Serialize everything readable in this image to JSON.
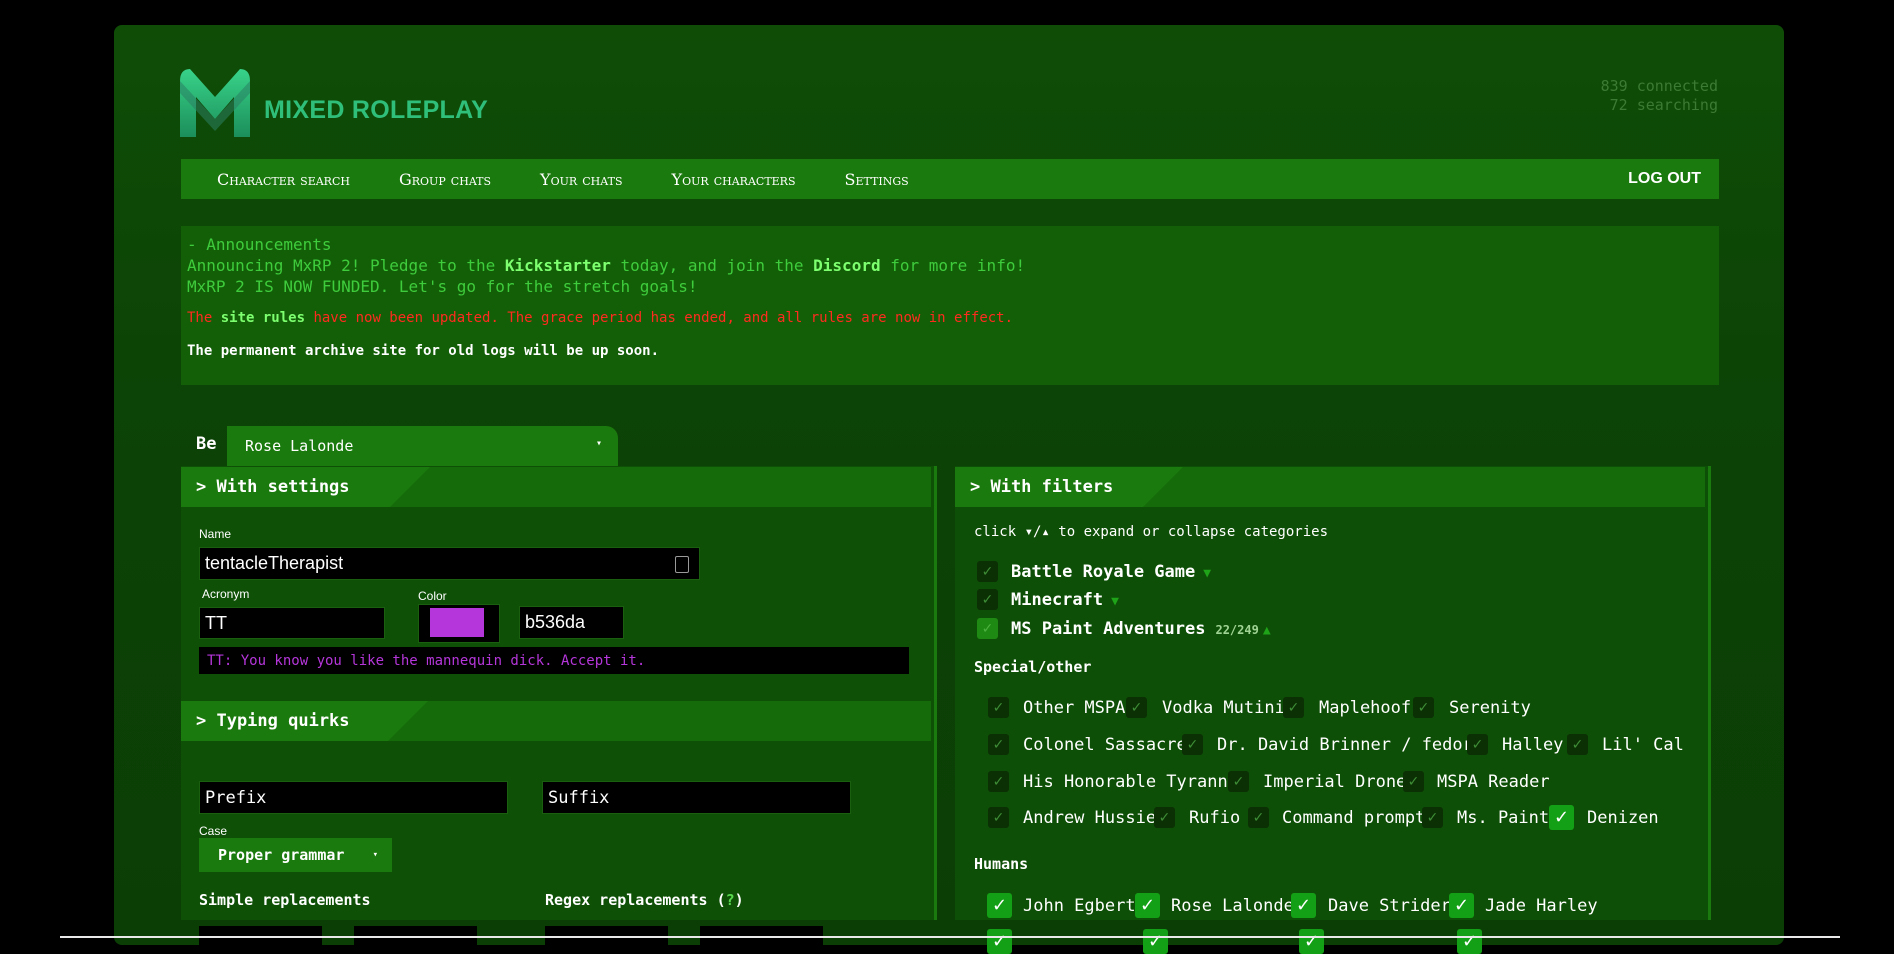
{
  "brand": {
    "name": "MIXED ROLEPLAY"
  },
  "stats": {
    "connected": "839 connected",
    "searching": "72 searching"
  },
  "nav": {
    "items": [
      "Character search",
      "Group chats",
      "Your chats",
      "Your characters",
      "Settings"
    ],
    "logout": "LOG OUT"
  },
  "announcements": {
    "title": "- Announcements",
    "line1_pre": "Announcing MxRP 2! Pledge to the ",
    "line1_link1": "Kickstarter",
    "line1_mid": " today, and join the ",
    "line1_link2": "Discord",
    "line1_post": " for more info!",
    "line2": "MxRP 2 IS NOW FUNDED. Let's go for the stretch goals!",
    "rules_pre": "The ",
    "rules_link": "site rules",
    "rules_post": " have now been updated. The grace period has ended, and all rules are now in effect.",
    "archive": "The permanent archive site for old logs will be up soon."
  },
  "be": {
    "label": "Be",
    "character": "Rose Lalonde",
    "caret": "▾"
  },
  "settings": {
    "heading": "> With settings",
    "name_label": "Name",
    "name_value": "tentacleTherapist",
    "acronym_label": "Acronym",
    "acronym_value": "TT",
    "color_label": "Color",
    "color_value": "b536da",
    "color_hex": "#b536da",
    "preview": "TT: You know you like the mannequin dick. Accept it."
  },
  "quirks": {
    "heading": "> Typing quirks",
    "prefix_placeholder": "Prefix",
    "suffix_placeholder": "Suffix",
    "case_label": "Case",
    "case_value": "Proper grammar",
    "simple_label": "Simple replacements",
    "regex_label": "Regex replacements (",
    "regex_q": "?",
    "regex_close": ")"
  },
  "filters": {
    "heading": "> With filters",
    "hint": "click ▾/▴ to expand or collapse categories",
    "categories": [
      {
        "name": "Battle Royale Game",
        "arrow": "▼"
      },
      {
        "name": "Minecraft",
        "arrow": "▼"
      },
      {
        "name": "MS Paint Adventures",
        "count": "22/249",
        "arrow": "▲"
      }
    ],
    "special_heading": "Special/other",
    "special_items": [
      [
        "Other MSPA",
        "Vodka Mutini",
        "Maplehoof",
        "Serenity"
      ],
      [
        "Colonel Sassacre",
        "Dr. David Brinner / fedora",
        "Halley",
        "Lil' Cal"
      ],
      [
        "His Honorable Tyranny",
        "Imperial Drone",
        "MSPA Reader"
      ],
      [
        "Andrew Hussie",
        "Rufio",
        "Command prompt",
        "Ms. Paint",
        "Denizen"
      ]
    ],
    "humans_heading": "Humans",
    "humans_items": [
      "John Egbert",
      "Rose Lalonde",
      "Dave Strider",
      "Jade Harley"
    ]
  },
  "colors": {
    "nav": "#1b7a0d",
    "accent": "#7dff6f",
    "warning": "#ff2b1f"
  }
}
